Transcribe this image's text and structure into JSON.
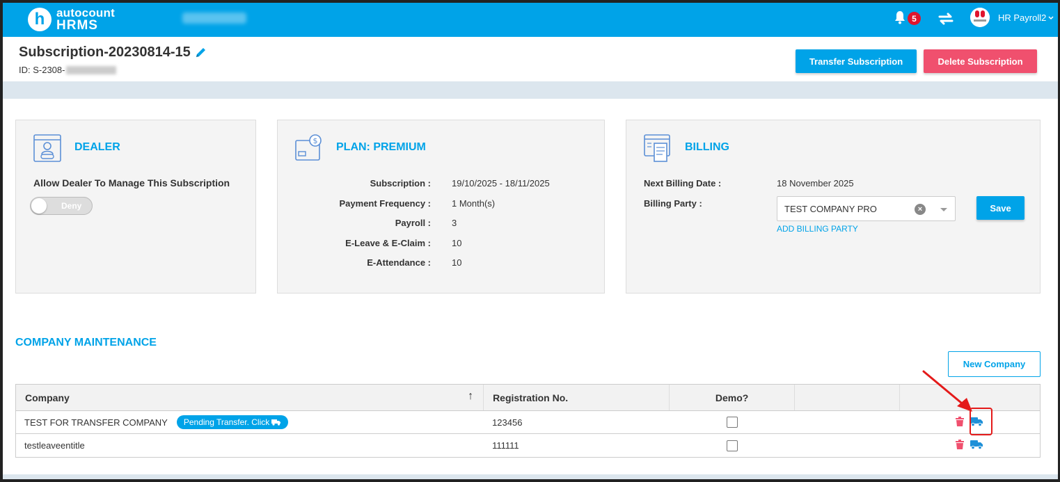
{
  "topbar": {
    "logo_letter": "h",
    "logo_line1": "autocount",
    "logo_line2": "HRMS",
    "notification_count": "5",
    "user_name": "HR Payroll2"
  },
  "header": {
    "title": "Subscription-20230814-15",
    "id_prefix": "ID: S-2308-",
    "transfer_label": "Transfer Subscription",
    "delete_label": "Delete Subscription"
  },
  "dealer": {
    "title": "DEALER",
    "allow_label": "Allow Dealer To Manage This Subscription",
    "toggle_label": "Deny"
  },
  "plan": {
    "title": "PLAN: PREMIUM",
    "rows": [
      {
        "label": "Subscription :",
        "value": "19/10/2025 - 18/11/2025"
      },
      {
        "label": "Payment Frequency :",
        "value": "1 Month(s)"
      },
      {
        "label": "Payroll :",
        "value": "3"
      },
      {
        "label": "E-Leave & E-Claim :",
        "value": "10"
      },
      {
        "label": "E-Attendance :",
        "value": "10"
      }
    ]
  },
  "billing": {
    "title": "BILLING",
    "next_label": "Next Billing Date :",
    "next_value": "18 November 2025",
    "party_label": "Billing Party :",
    "party_value": "TEST COMPANY PRO",
    "add_party": "ADD BILLING PARTY",
    "save_label": "Save"
  },
  "company": {
    "title": "COMPANY MAINTENANCE",
    "new_label": "New Company",
    "columns": [
      "Company",
      "Registration No.",
      "Demo?",
      "",
      ""
    ],
    "sort_glyph": "↑",
    "rows": [
      {
        "name": "TEST FOR TRANSFER COMPANY",
        "pending": "Pending Transfer. Click",
        "reg": "123456"
      },
      {
        "name": "testleaveentitle",
        "pending": "",
        "reg": "111111"
      }
    ]
  }
}
